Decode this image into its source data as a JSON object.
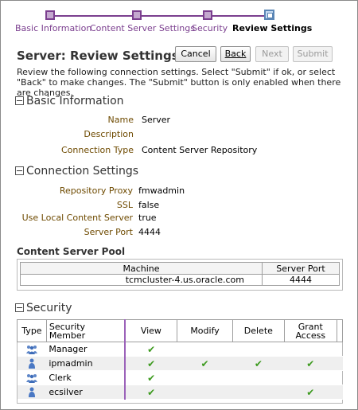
{
  "train": {
    "steps": [
      {
        "label": "Basic Information",
        "state": "visited"
      },
      {
        "label": "Content Server Settings",
        "state": "visited"
      },
      {
        "label": "Security",
        "state": "visited"
      },
      {
        "label": "Review Settings",
        "state": "current"
      }
    ]
  },
  "page": {
    "title": "Server: Review Settings",
    "instructions": "Review the following connection settings. Select \"Submit\" if ok, or select \"Back\" to make changes. The \"Submit\" button is only enabled when there are changes."
  },
  "buttons": {
    "cancel": "Cancel",
    "back": "Back",
    "next": "Next",
    "submit": "Submit"
  },
  "basic_info": {
    "heading": "Basic Information",
    "name_label": "Name",
    "name_value": "Server",
    "description_label": "Description",
    "description_value": "",
    "connection_type_label": "Connection Type",
    "connection_type_value": "Content Server Repository"
  },
  "connection_settings": {
    "heading": "Connection Settings",
    "repository_proxy_label": "Repository Proxy",
    "repository_proxy_value": "fmwadmin",
    "ssl_label": "SSL",
    "ssl_value": "false",
    "use_local_label": "Use Local Content Server",
    "use_local_value": "true",
    "server_port_label": "Server Port",
    "server_port_value": "4444"
  },
  "server_pool": {
    "heading": "Content Server Pool",
    "columns": [
      "Machine",
      "Server Port"
    ],
    "rows": [
      {
        "machine": "tcmcluster-4.us.oracle.com",
        "port": "4444"
      }
    ]
  },
  "security": {
    "heading": "Security",
    "columns": [
      "Type",
      "Security Member",
      "View",
      "Modify",
      "Delete",
      "Grant Access"
    ],
    "rows": [
      {
        "type": "group-icon",
        "member": "Manager",
        "view": true,
        "modify": false,
        "delete": false,
        "grant": false
      },
      {
        "type": "user-icon",
        "member": "ipmadmin",
        "view": true,
        "modify": true,
        "delete": true,
        "grant": true
      },
      {
        "type": "group-icon",
        "member": "Clerk",
        "view": true,
        "modify": false,
        "delete": false,
        "grant": false
      },
      {
        "type": "user-icon",
        "member": "ecsilver",
        "view": true,
        "modify": false,
        "delete": false,
        "grant": true
      }
    ]
  },
  "colors": {
    "train": "#7b3f8f",
    "label": "#6e4a00",
    "check": "#3c9a1e"
  }
}
